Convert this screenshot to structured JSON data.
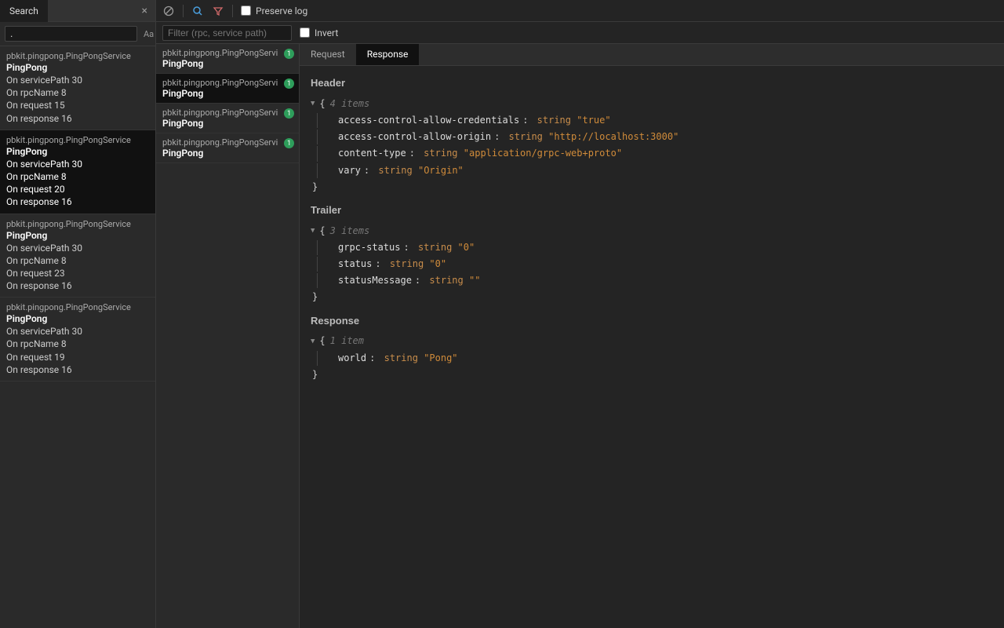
{
  "search": {
    "tab_label": "Search",
    "input_value": ".",
    "case_option": "Aa",
    "regex_option": ".*"
  },
  "toolbar": {
    "preserve_log_label": "Preserve log",
    "filter_placeholder": "Filter (rpc, service path)",
    "invert_label": "Invert"
  },
  "search_results": [
    {
      "path": "pbkit.pingpong.PingPongService",
      "method": "PingPong",
      "lines": [
        "On servicePath 30",
        "On rpcName 8",
        "On request 15",
        "On response 16"
      ],
      "selected": false
    },
    {
      "path": "pbkit.pingpong.PingPongService",
      "method": "PingPong",
      "lines": [
        "On servicePath 30",
        "On rpcName 8",
        "On request 20",
        "On response 16"
      ],
      "selected": true
    },
    {
      "path": "pbkit.pingpong.PingPongService",
      "method": "PingPong",
      "lines": [
        "On servicePath 30",
        "On rpcName 8",
        "On request 23",
        "On response 16"
      ],
      "selected": false
    },
    {
      "path": "pbkit.pingpong.PingPongService",
      "method": "PingPong",
      "lines": [
        "On servicePath 30",
        "On rpcName 8",
        "On request 19",
        "On response 16"
      ],
      "selected": false
    }
  ],
  "rpc_list": [
    {
      "path": "pbkit.pingpong.PingPongServi",
      "method": "PingPong",
      "badge": "1",
      "selected": false
    },
    {
      "path": "pbkit.pingpong.PingPongServi",
      "method": "PingPong",
      "badge": "1",
      "selected": true
    },
    {
      "path": "pbkit.pingpong.PingPongServi",
      "method": "PingPong",
      "badge": "1",
      "selected": false
    },
    {
      "path": "pbkit.pingpong.PingPongServi",
      "method": "PingPong",
      "badge": "1",
      "selected": false
    }
  ],
  "detail": {
    "tabs": {
      "request": "Request",
      "response": "Response"
    },
    "sections": [
      {
        "title": "Header",
        "count": "4 items",
        "rows": [
          {
            "key": "access-control-allow-credentials",
            "type": "string",
            "val": "\"true\""
          },
          {
            "key": "access-control-allow-origin",
            "type": "string",
            "val": "\"http://localhost:3000\""
          },
          {
            "key": "content-type",
            "type": "string",
            "val": "\"application/grpc-web+proto\""
          },
          {
            "key": "vary",
            "type": "string",
            "val": "\"Origin\""
          }
        ]
      },
      {
        "title": "Trailer",
        "count": "3 items",
        "rows": [
          {
            "key": "grpc-status",
            "type": "string",
            "val": "\"0\""
          },
          {
            "key": "status",
            "type": "string",
            "val": "\"0\""
          },
          {
            "key": "statusMessage",
            "type": "string",
            "val": "\"\""
          }
        ]
      },
      {
        "title": "Response",
        "count": "1 item",
        "rows": [
          {
            "key": "world",
            "type": "string",
            "val": "\"Pong\""
          }
        ]
      }
    ]
  }
}
